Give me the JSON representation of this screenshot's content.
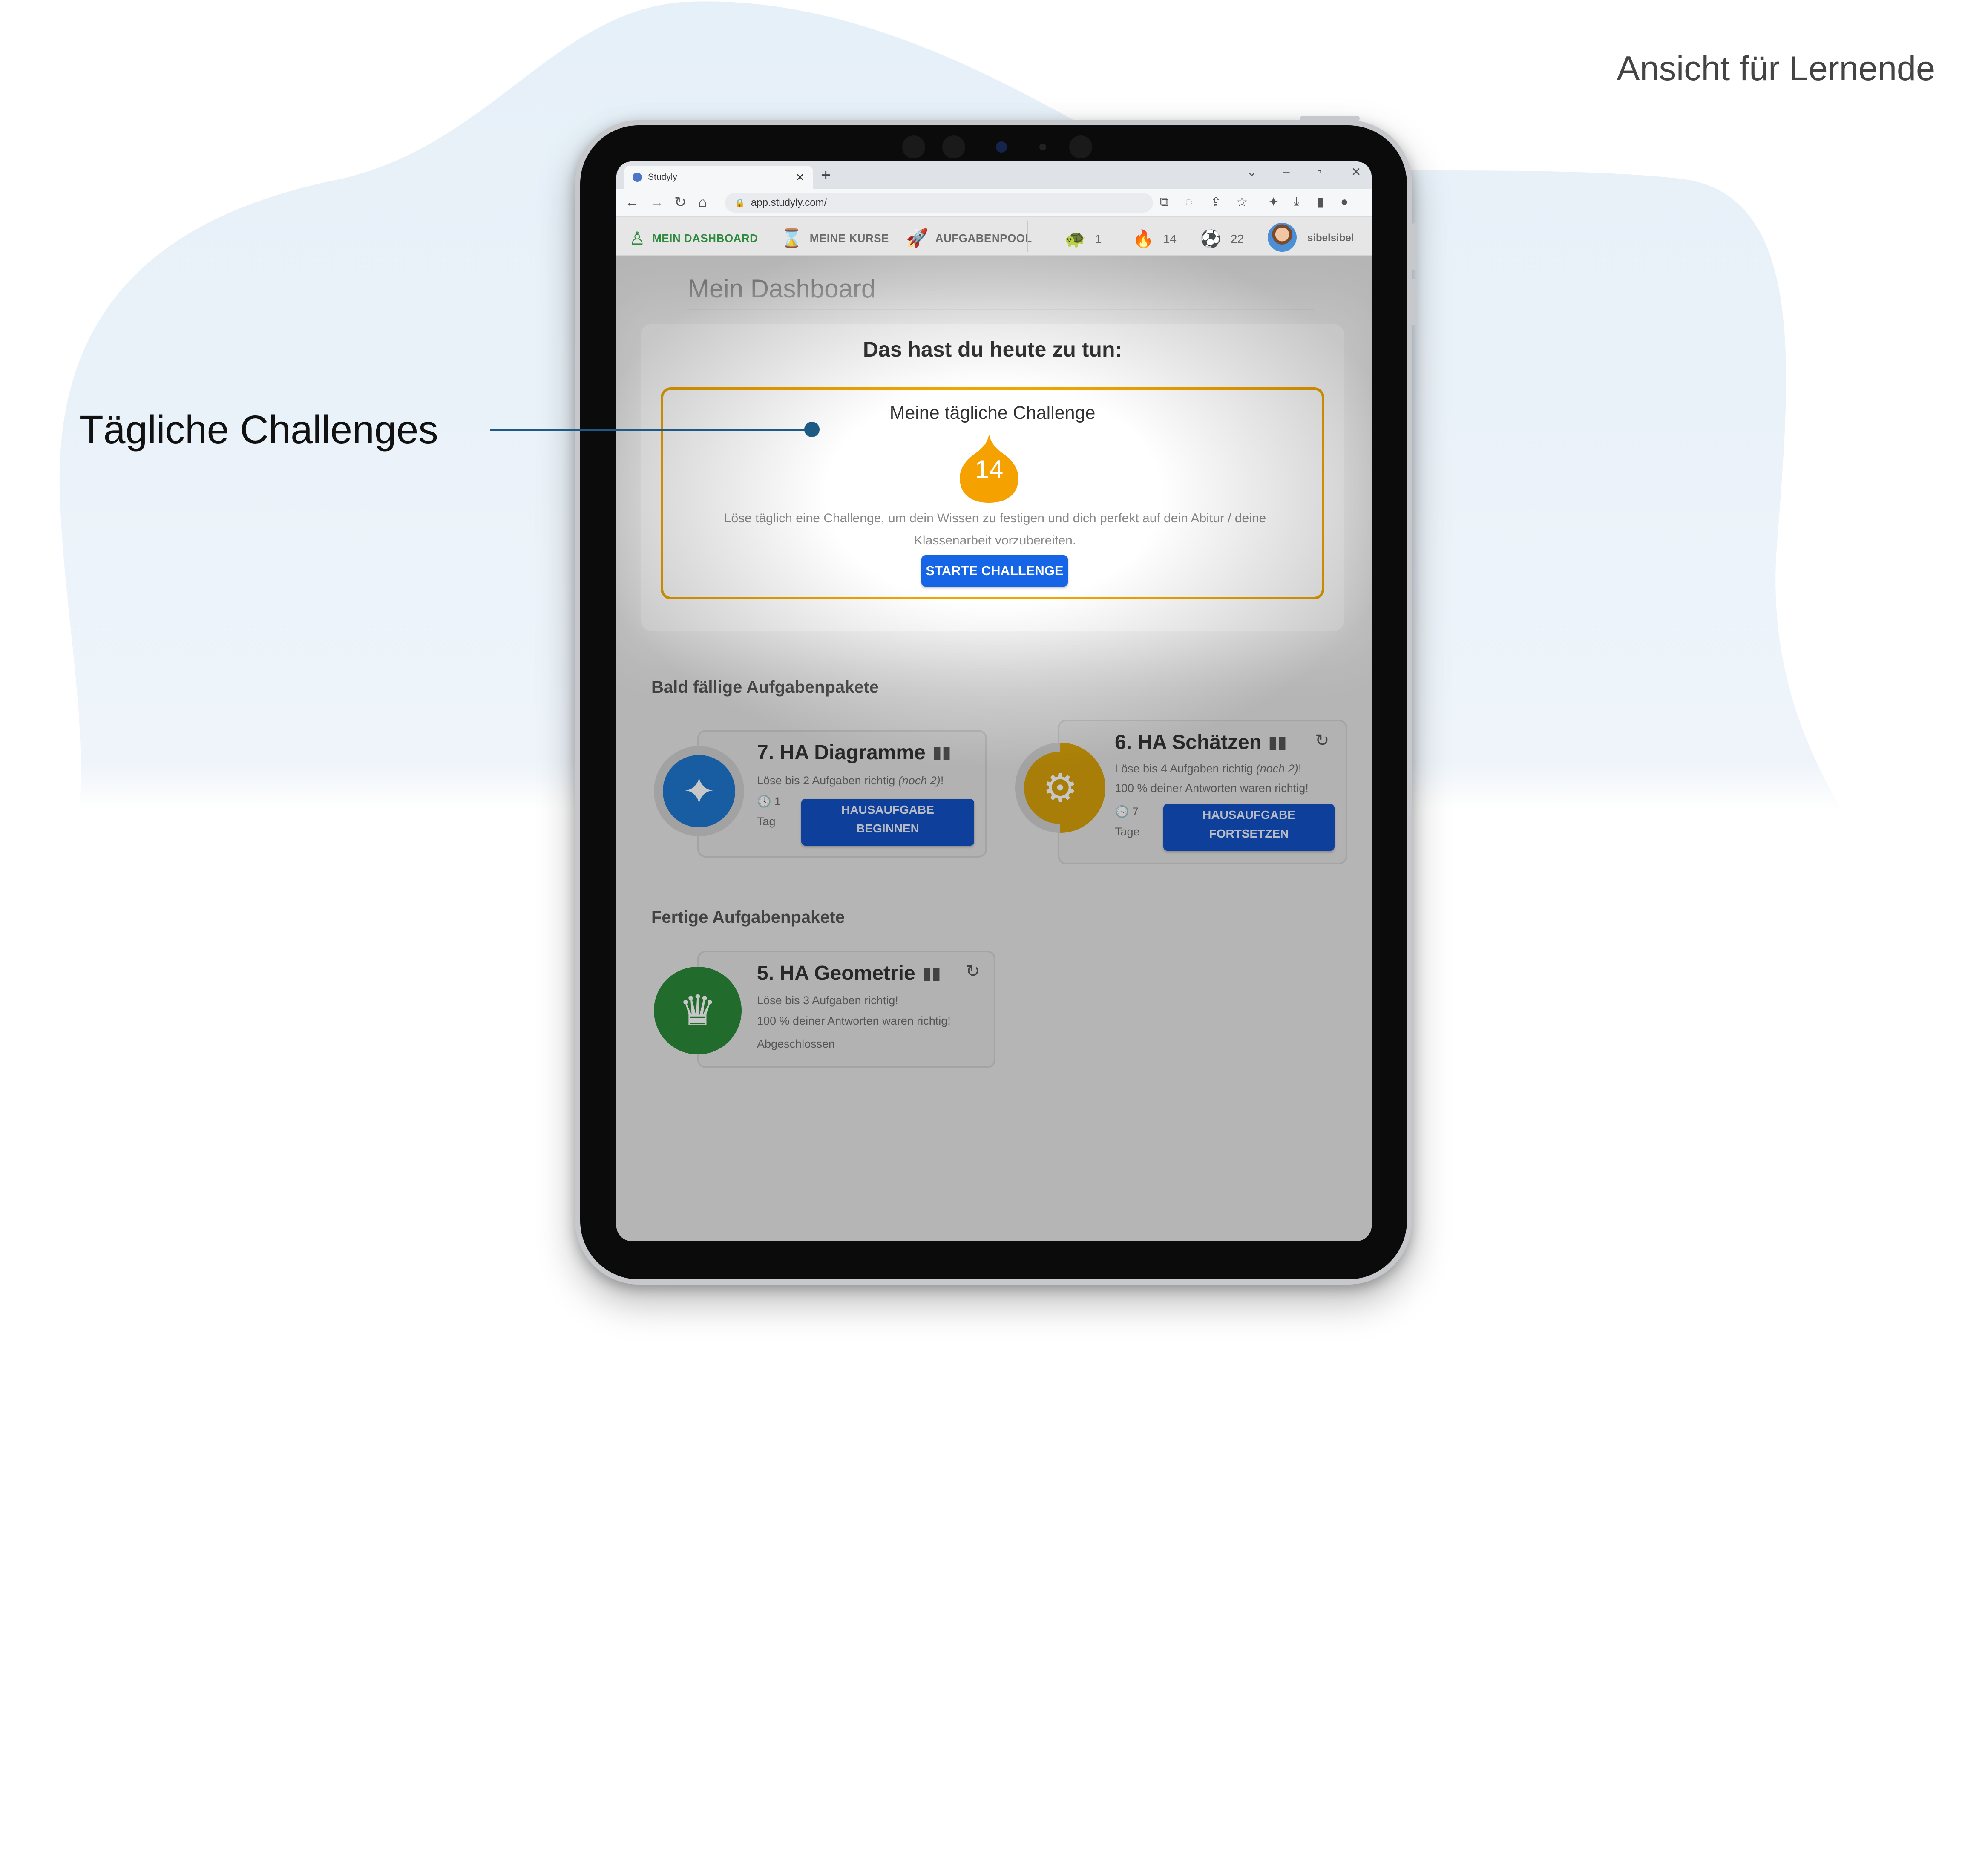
{
  "view_label": "Ansicht für Lernende",
  "callout": {
    "label": "Tägliche Challenges"
  },
  "browser": {
    "tab_title": "Studyly",
    "tab_close": "✕",
    "new_tab": "+",
    "url": "app.studyly.com/"
  },
  "nav": {
    "items": [
      {
        "label": "MEIN DASHBOARD",
        "icon": "user-icon",
        "active": true
      },
      {
        "label": "MEINE KURSE",
        "icon": "courses-icon",
        "active": false
      },
      {
        "label": "AUFGABENPOOL",
        "icon": "rocket-icon",
        "active": false
      }
    ],
    "stats": [
      {
        "icon": "turtle-icon",
        "value": "1"
      },
      {
        "icon": "flame-icon",
        "value": "14"
      },
      {
        "icon": "ball-icon",
        "value": "22"
      }
    ],
    "username": "sibelsibel"
  },
  "page": {
    "title": "Mein Dashboard",
    "today_title": "Das hast du heute zu tun:",
    "challenge": {
      "title": "Meine tägliche Challenge",
      "streak": "14",
      "description": "Löse täglich eine Challenge, um dein Wissen zu festigen und dich perfekt auf dein Abitur / deine Klassenarbeit vorzubereiten.",
      "button": "STARTE CHALLENGE",
      "accent_color": "#f0a500",
      "button_color": "#1565e6"
    },
    "due_section_title": "Bald fällige Aufgabenpakete",
    "done_section_title": "Fertige Aufgabenpakete",
    "due_tasks": [
      {
        "name": "7. HA Diagramme",
        "goal": "Löse bis 2 Aufgaben richtig",
        "goal_note": "(noch 2)",
        "goal_end": "!",
        "time_value": "1",
        "time_unit": "Tag",
        "button_line1": "HAUSAUFGABE",
        "button_line2": "BEGINNEN",
        "color": "#1f77d0",
        "progress": 0.0
      },
      {
        "name": "6. HA Schätzen",
        "goal": "Löse bis 4 Aufgaben richtig",
        "goal_note": "(noch 2)",
        "goal_end": "!",
        "result": "100 % deiner Antworten waren richtig!",
        "time_value": "7",
        "time_unit": "Tage",
        "button_line1": "HAUSAUFGABE",
        "button_line2": "FORTSETZEN",
        "color": "#d7a20a",
        "progress": 0.5
      }
    ],
    "done_tasks": [
      {
        "name": "5. HA Geometrie",
        "goal": "Löse bis 3 Aufgaben richtig!",
        "result": "100 % deiner Antworten waren richtig!",
        "status": "Abgeschlossen",
        "color": "#2a8a3a"
      }
    ]
  }
}
